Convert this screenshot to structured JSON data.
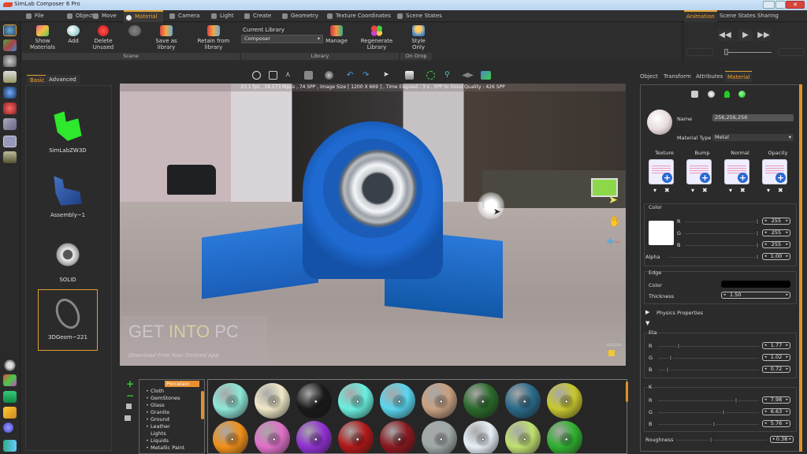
{
  "window": {
    "title": "SimLab Composer 6 Pro",
    "close": "✕"
  },
  "ribbon_tabs": [
    {
      "label": "File",
      "icon": "folder-icon"
    },
    {
      "label": "Object",
      "icon": "object-icon"
    },
    {
      "label": "Move",
      "icon": "move-icon"
    },
    {
      "label": "Material",
      "icon": "material-ball-icon",
      "active": true
    },
    {
      "label": "Camera",
      "icon": "camera-icon"
    },
    {
      "label": "Light",
      "icon": "light-icon"
    },
    {
      "label": "Create",
      "icon": "create-icon"
    },
    {
      "label": "Geometry",
      "icon": "geometry-icon"
    },
    {
      "label": "Texture Coordinates",
      "icon": "texture-coordinates-icon"
    },
    {
      "label": "Scene States",
      "icon": "scene-states-icon"
    }
  ],
  "ribbon": {
    "scene_buttons": [
      {
        "label": "Show Materials",
        "icon": "show-materials-icon"
      },
      {
        "label": "Add",
        "icon": "add-material-icon"
      },
      {
        "label": "Delete Unused",
        "icon": "delete-unused-icon"
      },
      {
        "label": "",
        "icon": "merge-icon",
        "disabled": true
      },
      {
        "label": "Save as library",
        "icon": "save-as-library-icon"
      },
      {
        "label": "Retain from library",
        "icon": "retain-from-library-icon"
      }
    ],
    "current_library_label": "Current Library",
    "current_library_value": "Composer",
    "library_buttons": [
      {
        "label": "Manage",
        "icon": "manage-library-icon"
      },
      {
        "label": "Regenerate Library",
        "icon": "regenerate-library-icon"
      }
    ],
    "on_drop_buttons": [
      {
        "label": "Style Only",
        "icon": "style-only-icon"
      }
    ],
    "groups": {
      "scene": "Scene",
      "library": "Library",
      "on_drop": "On Drop"
    }
  },
  "right_tabs": [
    {
      "label": "Animation",
      "active": true
    },
    {
      "label": "Scene States"
    },
    {
      "label": "Sharing Resources"
    }
  ],
  "animation": {
    "prev": "◀◀",
    "play": "▶",
    "next": "▶▶",
    "timeline_position": 0.0
  },
  "left_icons": [
    "scene-browser-icon",
    "materials-icon",
    "camera-view-icon",
    "book-icon",
    "light-bulb-icon",
    "render-icon",
    "animation-icon",
    "script-icon",
    "vr-icon",
    "settings-icon",
    "palette-icon",
    "display-icon",
    "keys-icon",
    "help-icon",
    "exit-icon"
  ],
  "scene_panel": {
    "tabs": [
      {
        "label": "Basic",
        "active": true
      },
      {
        "label": "Advanced"
      }
    ],
    "items": [
      {
        "label": "SimLabZW3D",
        "color": "#2ee82e"
      },
      {
        "label": "Assembly~1",
        "color": "#2a5ab0"
      },
      {
        "label": "SOLID",
        "color": "#bdbdbd"
      },
      {
        "label": "3DGeom~221",
        "color": "#8a8a8a",
        "selected": true
      }
    ]
  },
  "viewport": {
    "toolbar_icons": [
      "orbit-icon",
      "fit-region-icon",
      "measure-icon",
      "view-mode-icon",
      "shading-icon",
      "undo-icon",
      "redo-icon",
      "select-icon",
      "camera-mode-icon",
      "zoom-fit-icon",
      "zoom-icon",
      "ground-plane-icon",
      "render-icon"
    ],
    "status": "23.1 fps ,  18.573 Mpps  ,  74 SPP    ,  Image Size [ 1200 X 669 ] , Time Elapsed : 3 s , SPP to Good Quality : 426 SPP",
    "watermark_title_1": "GET ",
    "watermark_title_2": "INTO",
    "watermark_title_3": " PC",
    "watermark_subtitle": "Download Free Your Desired App",
    "side_tools": [
      "pointer-icon",
      "pan-hand-icon",
      "zoom-plus-minus-icon"
    ]
  },
  "library_tools": [
    {
      "label": "+",
      "icon": "add-icon"
    },
    {
      "label": "−",
      "icon": "remove-icon"
    },
    {
      "label": "",
      "icon": "library-books-icon"
    },
    {
      "label": "",
      "icon": "view-options-icon"
    }
  ],
  "library_tree": {
    "selected": "Porcelain",
    "items": [
      {
        "label": "Cloth",
        "bullet": true
      },
      {
        "label": "GemStones",
        "bullet": true
      },
      {
        "label": "Glass",
        "bullet": true
      },
      {
        "label": "Granite",
        "bullet": true
      },
      {
        "label": "Ground",
        "bullet": true
      },
      {
        "label": "Leather",
        "bullet": true
      },
      {
        "label": "Lights",
        "bullet": false
      },
      {
        "label": "Liquids",
        "bullet": true
      },
      {
        "label": "Metallic Paint",
        "bullet": true
      }
    ]
  },
  "library_swatches": {
    "row1": [
      "#8ee8d8",
      "#f0e8c8",
      "#1a1a1a",
      "#6af0e0",
      "#5ad6f0",
      "#c8a080",
      "#2a6a2a",
      "#2a6a8a",
      "#c8c830"
    ],
    "row2": [
      "#f0901a",
      "#e070c8",
      "#9030d0",
      "#b01818",
      "#8a1820",
      "#a0a8a8",
      "#e8f0f8",
      "#c0e070",
      "#30b030"
    ]
  },
  "prop_tabs": [
    {
      "label": "Object"
    },
    {
      "label": "Transform"
    },
    {
      "label": "Attributes"
    },
    {
      "label": "Material",
      "active": true
    }
  ],
  "material": {
    "mode_icons": [
      "material-list-icon",
      "material-sphere-icon",
      "pin-icon",
      "green-ball-icon"
    ],
    "name_label": "Name",
    "name_value": "256,256,256",
    "type_label": "Material Type",
    "type_value": "Metal",
    "maps": [
      {
        "label": "Texture"
      },
      {
        "label": "Bump"
      },
      {
        "label": "Normal"
      },
      {
        "label": "Opacity"
      }
    ],
    "map_controls": {
      "dropdown": "▾",
      "remove": "✖"
    },
    "color": {
      "label": "Color",
      "swatch": "#ffffff",
      "channels": [
        {
          "label": "R",
          "value": "255",
          "fraction": 1.0
        },
        {
          "label": "G",
          "value": "255",
          "fraction": 1.0
        },
        {
          "label": "B",
          "value": "255",
          "fraction": 1.0
        }
      ],
      "alpha_label": "Alpha",
      "alpha_value": "1.00",
      "alpha_fraction": 1.0
    },
    "edge": {
      "label": "Edge",
      "color_label": "Color",
      "color_value": "#000000",
      "thickness_label": "Thickness",
      "thickness_value": "1.50"
    },
    "physics_label": "Physics Properties",
    "eta": {
      "label": "Eta",
      "channels": [
        {
          "label": "R",
          "value": "1.77",
          "fraction": 0.19
        },
        {
          "label": "G",
          "value": "1.02",
          "fraction": 0.11
        },
        {
          "label": "B",
          "value": "0.72",
          "fraction": 0.08
        }
      ]
    },
    "k": {
      "label": "K",
      "channels": [
        {
          "label": "R",
          "value": "7.98",
          "fraction": 0.78
        },
        {
          "label": "G",
          "value": "6.63",
          "fraction": 0.65
        },
        {
          "label": "B",
          "value": "5.76",
          "fraction": 0.56
        }
      ]
    },
    "roughness_label": "Roughness",
    "roughness_value": "0.38",
    "roughness_fraction": 0.38
  }
}
